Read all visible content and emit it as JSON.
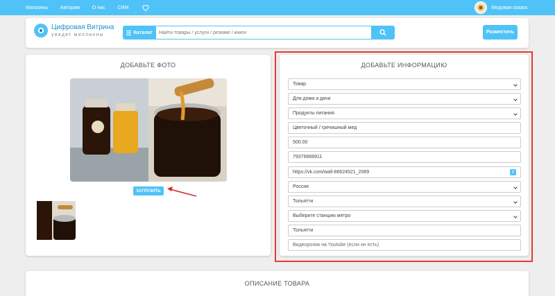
{
  "topbar": {
    "nav": [
      "Магазины",
      "Авторам",
      "О нас",
      "CRM"
    ],
    "user_name": "Медовая сказка"
  },
  "header": {
    "logo_title": "Цифровая Витрина",
    "logo_subtitle": "увидят миллионы",
    "catalog_label": "Каталог",
    "search_placeholder": "Найти товары / услуги / резюме / книги",
    "place_button": "Разместить"
  },
  "photo": {
    "title": "ДОБАВЬТЕ ФОТО",
    "upload_button": "ЗАГРУЗИТЬ"
  },
  "info": {
    "title": "ДОБАВЬТЕ ИНФОРМАЦИЮ",
    "fields": [
      {
        "value": "Товар",
        "type": "select"
      },
      {
        "value": "Для дома и дачи",
        "type": "select"
      },
      {
        "value": "Продукты питания",
        "type": "select"
      },
      {
        "value": "Цветочный / гречишный мед",
        "type": "text"
      },
      {
        "value": "500.00",
        "type": "text"
      },
      {
        "value": "79376668911",
        "type": "text"
      },
      {
        "value": "https://vk.com/wall-86624521_2069",
        "type": "text"
      },
      {
        "value": "Россия",
        "type": "select"
      },
      {
        "value": "Тольятти",
        "type": "select"
      },
      {
        "value": "Выберите станцию метро",
        "type": "select"
      },
      {
        "value": "Тольятти",
        "type": "text"
      },
      {
        "value": "Видеоролик на Youtube (если он есть)",
        "type": "placeholder"
      }
    ]
  },
  "description": {
    "title": "ОПИСАНИЕ ТОВАРА"
  },
  "colors": {
    "accent": "#4fc3f7",
    "highlight": "#e53935"
  }
}
